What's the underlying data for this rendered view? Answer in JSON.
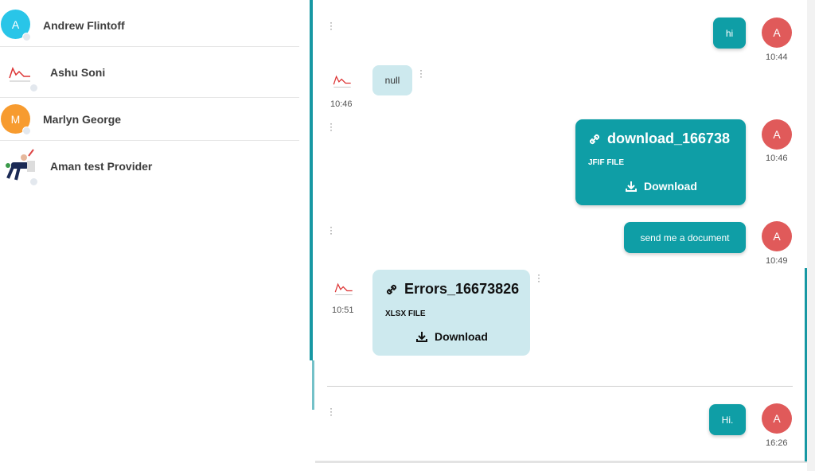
{
  "contacts": [
    {
      "name": "Andrew Flintoff",
      "initial": "A",
      "color": "#29c5e8"
    },
    {
      "name": "Ashu Soni",
      "initial": "",
      "color": ""
    },
    {
      "name": "Marlyn George",
      "initial": "M",
      "color": "#f79b2f"
    },
    {
      "name": "Aman test Provider",
      "initial": "",
      "color": ""
    }
  ],
  "messages": {
    "m1": {
      "text": "hi",
      "avatar": "A",
      "time": "10:44"
    },
    "m2": {
      "text": "null",
      "time": "10:46"
    },
    "m3": {
      "file_name": "download_166738",
      "file_type": "JFIF FILE",
      "download": "Download",
      "avatar": "A",
      "time": "10:46"
    },
    "m4": {
      "text": "send me a document",
      "avatar": "A",
      "time": "10:49"
    },
    "m5": {
      "file_name": "Errors_16673826",
      "file_type": "XLSX FILE",
      "download": "Download",
      "time": "10:51"
    },
    "m6": {
      "text": "Hi.",
      "avatar": "A",
      "time": "16:26"
    }
  },
  "colors": {
    "accent": "#0f9ea6",
    "incoming": "#cde9ee",
    "avatar_red": "#e05a5a"
  }
}
